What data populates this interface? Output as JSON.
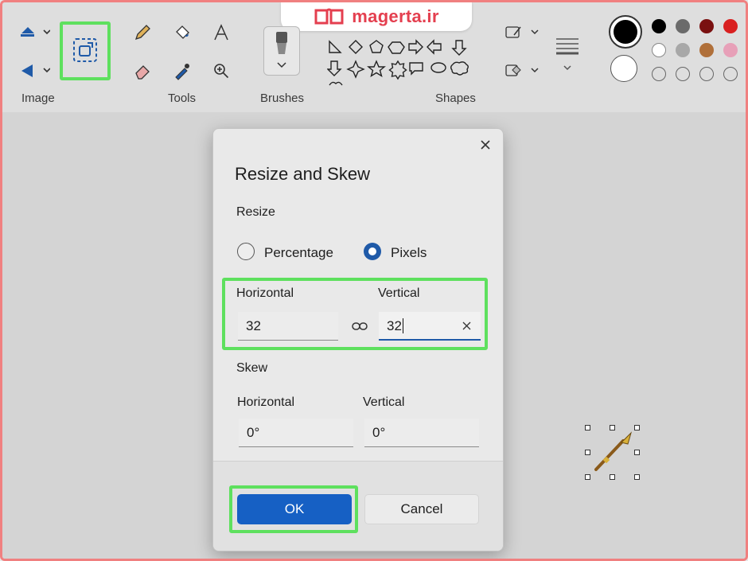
{
  "watermark": {
    "text": "magerta.ir"
  },
  "ribbon": {
    "groups": {
      "image": "Image",
      "tools": "Tools",
      "brushes": "Brushes",
      "shapes": "Shapes"
    },
    "tools": [
      "pencil-icon",
      "fill-bucket-icon",
      "text-icon",
      "eraser-icon",
      "color-picker-icon",
      "magnifier-icon"
    ],
    "image_tools": [
      "select-icon",
      "resize-icon",
      "rotate-icon"
    ],
    "colors": {
      "primary": "#000000",
      "secondary": "#ffffff",
      "palette_row1": [
        "#000000",
        "#6b6b6b",
        "#7a1010",
        "#d92020"
      ],
      "palette_row2": [
        "#ffffff",
        "#a8a8a8",
        "#b0703a",
        "#e7a0b8"
      ]
    }
  },
  "dialog": {
    "title": "Resize and Skew",
    "resize_section": "Resize",
    "option_percentage": "Percentage",
    "option_pixels": "Pixels",
    "selected_option": "Pixels",
    "resize_horizontal_label": "Horizontal",
    "resize_vertical_label": "Vertical",
    "resize_horizontal_value": "32",
    "resize_vertical_value": "32",
    "skew_section": "Skew",
    "skew_horizontal_label": "Horizontal",
    "skew_vertical_label": "Vertical",
    "skew_horizontal_value": "0°",
    "skew_vertical_value": "0°",
    "ok_label": "OK",
    "cancel_label": "Cancel"
  }
}
